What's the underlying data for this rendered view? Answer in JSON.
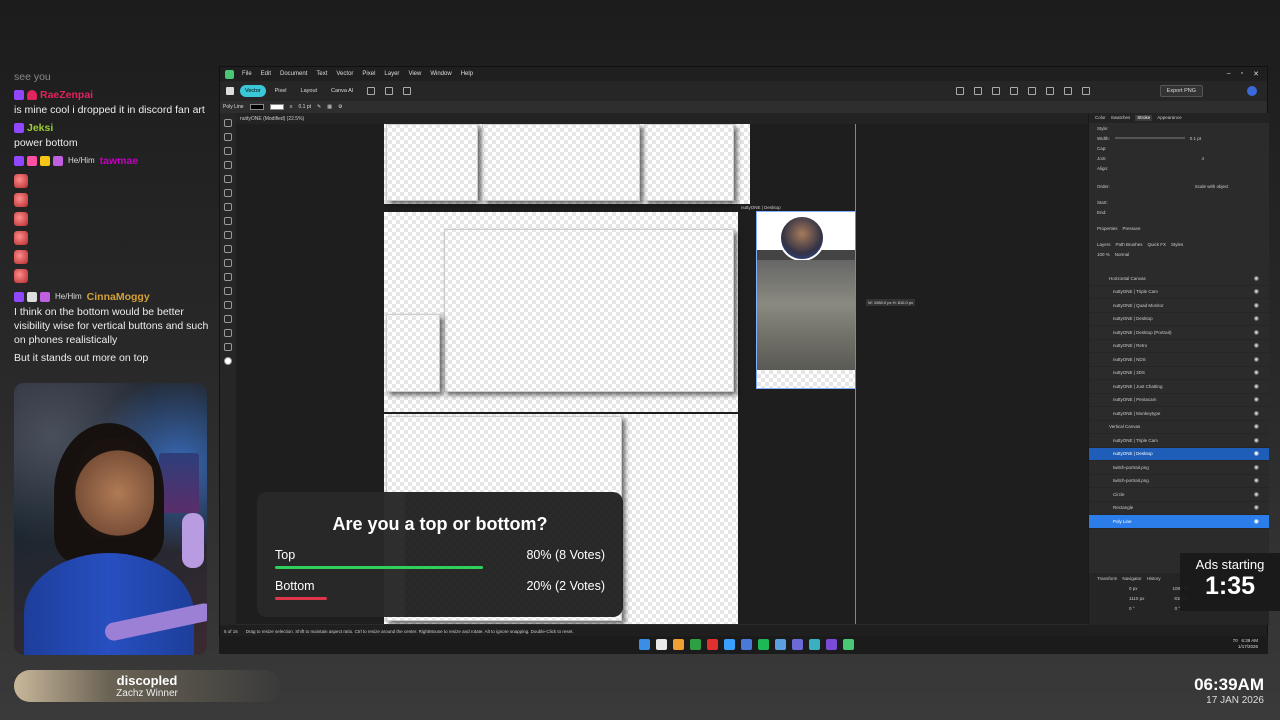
{
  "chat": {
    "faded_line": "see you",
    "messages": [
      {
        "user": "RaeZenpai",
        "color": "#e0245e",
        "text": "is mine cool i dropped it in discord fan art"
      },
      {
        "user": "Jeksi",
        "color": "#9acd32",
        "text": "power bottom"
      },
      {
        "user": "tawmae",
        "color": "#c000c0",
        "pronouns": "He/Him",
        "text": ""
      },
      {
        "user": "CinnaMoggy",
        "color": "#d2a038",
        "pronouns": "He/Him",
        "text": "I think on the bottom would be better visibility wise for vertical buttons and such on phones realistically",
        "text2": "But it stands out more on top"
      }
    ]
  },
  "namebar": {
    "name": "discopled",
    "subtitle": "Zachz Winner"
  },
  "app": {
    "menu": [
      "File",
      "Edit",
      "Document",
      "Text",
      "Vector",
      "Pixel",
      "Layer",
      "View",
      "Window",
      "Help"
    ],
    "personas": [
      "Vector",
      "Pixel",
      "Layout",
      "Canva AI"
    ],
    "export_label": "Export PNG",
    "context": {
      "tool": "Poly Line",
      "width": "0.1 pt"
    },
    "doc_tab": "nuttyONE (Modified) (22.5%)",
    "artboard_label": "nuttyONE | Desktop",
    "dimension_label": "W: 1080.0 px  H: 810.0 px",
    "right_tabs": [
      "Color",
      "Swatches",
      "Stroke",
      "Appearance"
    ],
    "stroke_rows": [
      "Style:",
      "Width:",
      "Cap:",
      "Join:",
      "Align:",
      "Order:",
      "Start:",
      "End:"
    ],
    "stroke_width": "0.1 pt",
    "mitre": "4",
    "scale_with_object": "Scale with object",
    "props_tabs": [
      "Properties",
      "Pressure"
    ],
    "layer_tabs": [
      "Layers",
      "Path Brushes",
      "Quick FX",
      "Styles"
    ],
    "opacity": "100 %",
    "blend": "Normal",
    "layers": [
      {
        "name": "Horizontal Canvas",
        "type": "group"
      },
      {
        "name": "nuttyONE | Triple Cam",
        "type": "item"
      },
      {
        "name": "nuttyONE | Quad Monitor",
        "type": "item"
      },
      {
        "name": "nuttyONE | Desktop",
        "type": "item"
      },
      {
        "name": "nuttyONE | Desktop (Portrait)",
        "type": "item"
      },
      {
        "name": "nuttyONE | Retro",
        "type": "item"
      },
      {
        "name": "nuttyONE | NDS",
        "type": "item"
      },
      {
        "name": "nuttyONE | 3DS",
        "type": "item"
      },
      {
        "name": "nuttyONE | Just Chatting",
        "type": "item"
      },
      {
        "name": "nuttyONE | Pentacam",
        "type": "item"
      },
      {
        "name": "nuttyONE | Monkeytype",
        "type": "item"
      },
      {
        "name": "Vertical Canvas",
        "type": "group"
      },
      {
        "name": "nuttyONE | Triple Cam",
        "type": "item"
      },
      {
        "name": "nuttyONE | Desktop",
        "type": "selected"
      },
      {
        "name": "twitch-portrait.png",
        "type": "item"
      },
      {
        "name": "twitch-portrait.png",
        "type": "item"
      },
      {
        "name": "Circle",
        "type": "item"
      },
      {
        "name": "Rectangle",
        "type": "item"
      },
      {
        "name": "Poly Line",
        "type": "active"
      }
    ],
    "transform_tabs": [
      "Transform",
      "Navigator",
      "History"
    ],
    "transform": {
      "x": "0 px",
      "y": "1110 px",
      "w": "1080 px",
      "h": "810 px",
      "r": "0 °",
      "s": "0 °"
    },
    "page_indicator": "5 of 16",
    "status_text": "Drag to resize selection. Shift to maintain aspect ratio. Ctrl to resize around the center. RightMouse to resize and rotate. Alt to ignore snapping. Double-Click to reset."
  },
  "taskbar": {
    "icon_colors": [
      "#3a8ee6",
      "#e8e8e8",
      "#f0a030",
      "#2ea043",
      "#e03030",
      "#3aa0ff",
      "#4a7ad8",
      "#1db954",
      "#5aa0e0",
      "#6a6ad8",
      "#3ab0c0",
      "#7a4ad8",
      "#48c774"
    ],
    "tray_time": "6:39 AM",
    "tray_date": "1/17/2026",
    "tray_num": "70"
  },
  "poll": {
    "question": "Are you a top or bottom?",
    "options": [
      {
        "label": "Top",
        "result": "80% (8 Votes)",
        "fraction": 0.8,
        "color": "#2fd15a"
      },
      {
        "label": "Bottom",
        "result": "20% (2 Votes)",
        "fraction": 0.2,
        "color": "#e0344a"
      }
    ]
  },
  "ads": {
    "label": "Ads starting",
    "countdown": "1:35"
  },
  "clock": {
    "time": "06:39AM",
    "date": "17 JAN 2026"
  }
}
